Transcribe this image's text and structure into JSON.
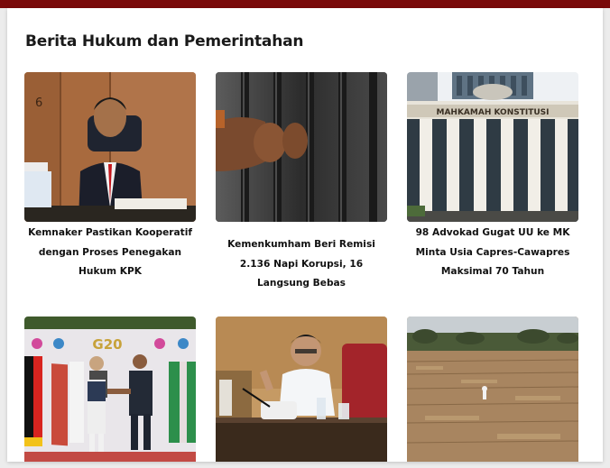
{
  "section": {
    "title": "Berita Hukum dan Pemerintahan"
  },
  "articles": [
    {
      "headline": "Kemnaker Pastikan Kooperatif dengan Proses Penegakan Hukum KPK",
      "image": "official-at-desk-photo"
    },
    {
      "headline": "Kemenkumham Beri Remisi 2.136 Napi Korupsi, 16 Langsung Bebas",
      "image": "prison-bars-hands-photo"
    },
    {
      "headline": "98 Advokad Gugat UU ke MK Minta Usia Capres-Cawapres Maksimal 70 Tahun",
      "image": "mahkamah-konstitusi-building-photo"
    },
    {
      "headline": "",
      "image": "g20-handshake-photo"
    },
    {
      "headline": "",
      "image": "minister-speaking-meeting-photo"
    },
    {
      "headline": "",
      "image": "dry-rice-field-photo"
    }
  ],
  "photo_text": {
    "building_sign": "MAHKAMAH KONSTITUSI",
    "g20_logo": "G20"
  },
  "colors": {
    "topbar": "#7a0a0a",
    "title": "#1a1a1a"
  }
}
